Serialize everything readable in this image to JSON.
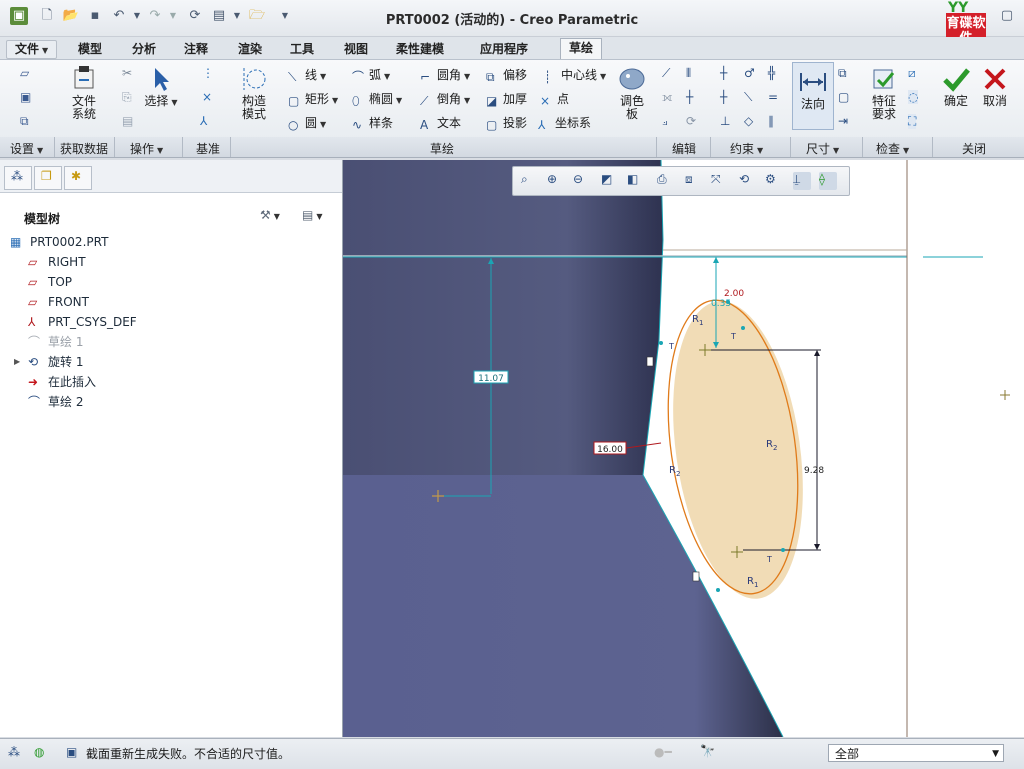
{
  "window": {
    "title": "PRT0002 (活动的) - Creo Parametric",
    "logo_text": "育碟软件",
    "logo_mark": "YY"
  },
  "tabs": [
    {
      "label": "文件",
      "dropdown": true
    },
    {
      "label": "模型"
    },
    {
      "label": "分析"
    },
    {
      "label": "注释"
    },
    {
      "label": "渲染"
    },
    {
      "label": "工具"
    },
    {
      "label": "视图"
    },
    {
      "label": "柔性建模"
    },
    {
      "label": "应用程序"
    },
    {
      "label": "草绘",
      "active": true
    }
  ],
  "ribbon": {
    "setup": {
      "coord_system": "文件\n系统"
    },
    "operations": {
      "select": "选择"
    },
    "datum": {},
    "construct_mode": "构造\n模式",
    "sketch": {
      "line": "线",
      "arc": "弧",
      "fillet": "圆角",
      "offset": "偏移",
      "centerline": "中心线",
      "rectangle": "矩形",
      "ellipse": "椭圆",
      "chamfer": "倒角",
      "thicken": "加厚",
      "point": "点",
      "circle": "圆",
      "spline": "样条",
      "text": "文本",
      "project": "投影",
      "coordsys": "坐标系"
    },
    "palette": "调色\n板",
    "dimension": {
      "normal": "法向"
    },
    "inspect": {
      "feature_requirements": "特征\n要求"
    },
    "close": {
      "ok": "确定",
      "cancel": "取消"
    }
  },
  "groups": {
    "setup": "设置",
    "get_data": "获取数据",
    "operations": "操作",
    "datum": "基准",
    "sketch": "草绘",
    "edit": "编辑",
    "constrain": "约束",
    "dimension": "尺寸",
    "inspect": "检查",
    "close": "关闭"
  },
  "model_tree": {
    "title": "模型树",
    "items": [
      {
        "label": "PRT0002.PRT",
        "icon": "part-icon",
        "level": 0
      },
      {
        "label": "RIGHT",
        "icon": "datum-plane-icon",
        "level": 1
      },
      {
        "label": "TOP",
        "icon": "datum-plane-icon",
        "level": 1
      },
      {
        "label": "FRONT",
        "icon": "datum-plane-icon",
        "level": 1
      },
      {
        "label": "PRT_CSYS_DEF",
        "icon": "csys-icon",
        "level": 1
      },
      {
        "label": "草绘 1",
        "icon": "sketch-icon",
        "level": 1,
        "dim": true
      },
      {
        "label": "旋转 1",
        "icon": "revolve-icon",
        "level": 1,
        "expandable": true
      },
      {
        "label": "在此插入",
        "icon": "insert-here-icon",
        "level": 1
      },
      {
        "label": "草绘 2",
        "icon": "sketch-icon",
        "level": 1,
        "active": true
      }
    ]
  },
  "sketch": {
    "dim_height": "11.07",
    "dim_offset": "16.00",
    "dim_top": "2.00",
    "dim_top_small": "0.35",
    "dim_right": "9.28",
    "label_r1": "R",
    "label_r1_sub": "1",
    "label_r2": "R",
    "label_r2_sub": "2",
    "label_t": "T"
  },
  "status": {
    "message": "截面重新生成失败。不合适的尺寸值。",
    "filter": "全部"
  },
  "colors": {
    "accent": "#2a6db5",
    "model_dark": "#4c5278",
    "sketch_orange": "#e07b1a",
    "sketch_fill": "#efd8ae",
    "dimension_cyan": "#1aa6b4",
    "error_red": "#b0191e"
  }
}
